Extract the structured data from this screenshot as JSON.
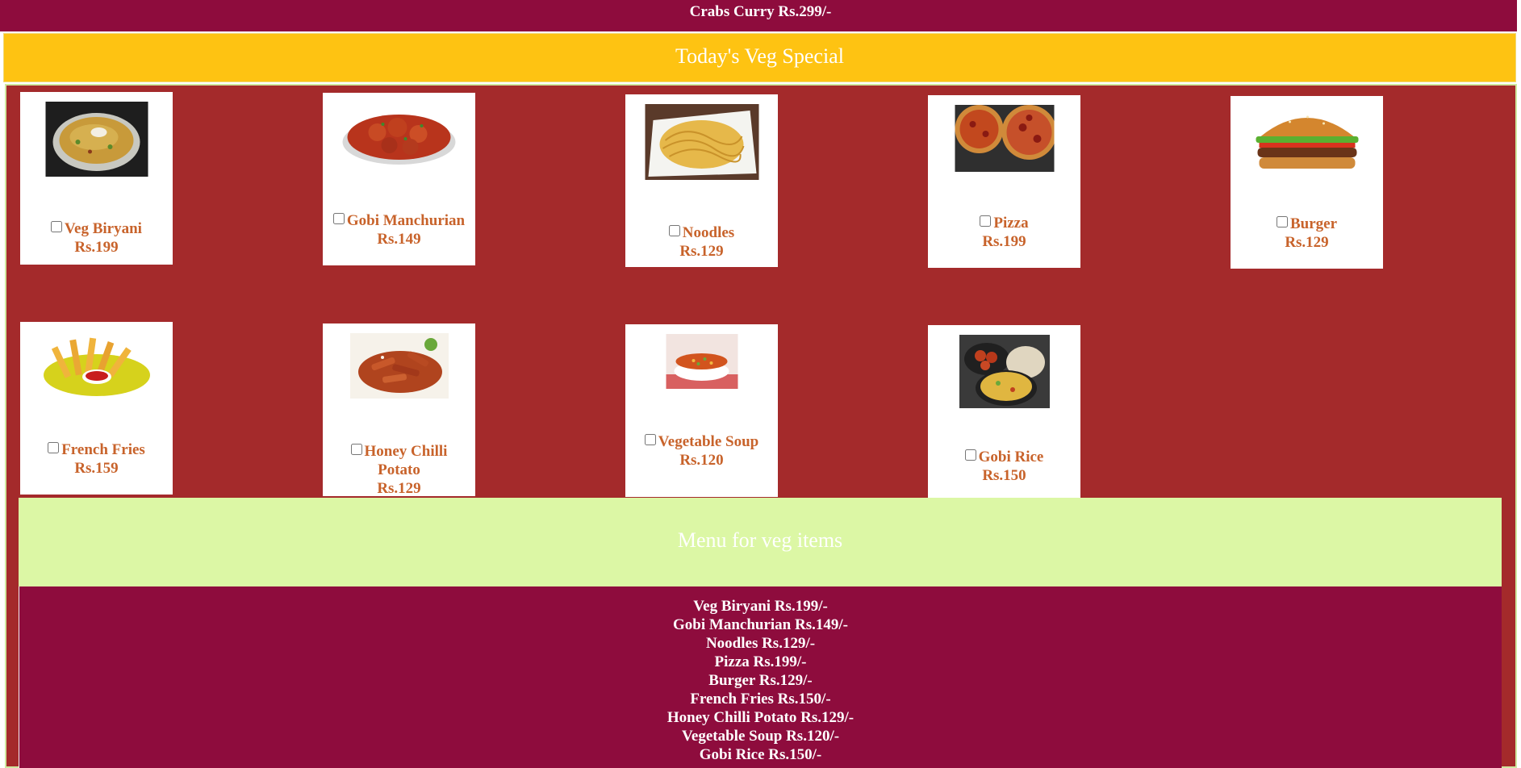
{
  "top_banner": {
    "text": "Crabs Curry Rs.299/-"
  },
  "veg_special": {
    "title": "Today's Veg Special"
  },
  "items": [
    {
      "name": "Veg Biryani",
      "price": "Rs.199"
    },
    {
      "name": "Gobi Manchurian",
      "price": "Rs.149"
    },
    {
      "name": "Noodles",
      "price": "Rs.129"
    },
    {
      "name": "Pizza",
      "price": "Rs.199"
    },
    {
      "name": "Burger",
      "price": "Rs.129"
    },
    {
      "name": "French Fries",
      "price": "Rs.159"
    },
    {
      "name": "Honey Chilli Potato",
      "price": "Rs.129"
    },
    {
      "name": "Vegetable Soup",
      "price": "Rs.120"
    },
    {
      "name": "Gobi Rice",
      "price": "Rs.150"
    }
  ],
  "menu": {
    "title": "Menu for veg items",
    "entries": [
      "Veg Biryani Rs.199/-",
      "Gobi Manchurian Rs.149/-",
      "Noodles Rs.129/-",
      "Pizza Rs.199/-",
      "Burger Rs.129/-",
      "French Fries Rs.150/-",
      "Honey Chilli Potato Rs.129/-",
      "Vegetable Soup Rs.120/-",
      "Gobi Rice Rs.150/-"
    ]
  },
  "colors": {
    "banner": "#8e0c3d",
    "veg_header": "#fec312",
    "items_background": "#a42a2b",
    "menu_header": "#dcf7a5",
    "item_text": "#c8632b"
  }
}
